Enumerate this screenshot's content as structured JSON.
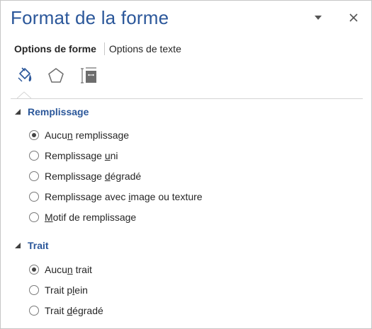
{
  "pane": {
    "title": "Format de la forme"
  },
  "tabs": {
    "active": "Options de forme",
    "other": "Options de texte"
  },
  "icons": [
    "paint-bucket-icon",
    "pentagon-icon",
    "size-properties-icon",
    "dropdown-arrow-icon",
    "close-icon"
  ],
  "sections": {
    "fill": {
      "header": "Remplissage",
      "options": [
        {
          "pre": "Aucu",
          "mn": "n",
          "post": " remplissage",
          "checked": true
        },
        {
          "pre": "Remplissage ",
          "mn": "u",
          "post": "ni",
          "checked": false
        },
        {
          "pre": "Remplissage ",
          "mn": "d",
          "post": "égradé",
          "checked": false
        },
        {
          "pre": "Remplissage avec ",
          "mn": "i",
          "post": "mage ou texture",
          "checked": false
        },
        {
          "pre": "",
          "mn": "M",
          "post": "otif de remplissage",
          "checked": false
        }
      ]
    },
    "line": {
      "header": "Trait",
      "options": [
        {
          "pre": "Aucu",
          "mn": "n",
          "post": " trait",
          "checked": true
        },
        {
          "pre": "Trait p",
          "mn": "l",
          "post": "ein",
          "checked": false
        },
        {
          "pre": "Trait ",
          "mn": "d",
          "post": "égradé",
          "checked": false
        }
      ]
    }
  },
  "colors": {
    "accent": "#2b579a",
    "text": "#262626",
    "border": "#c6c6c6"
  }
}
